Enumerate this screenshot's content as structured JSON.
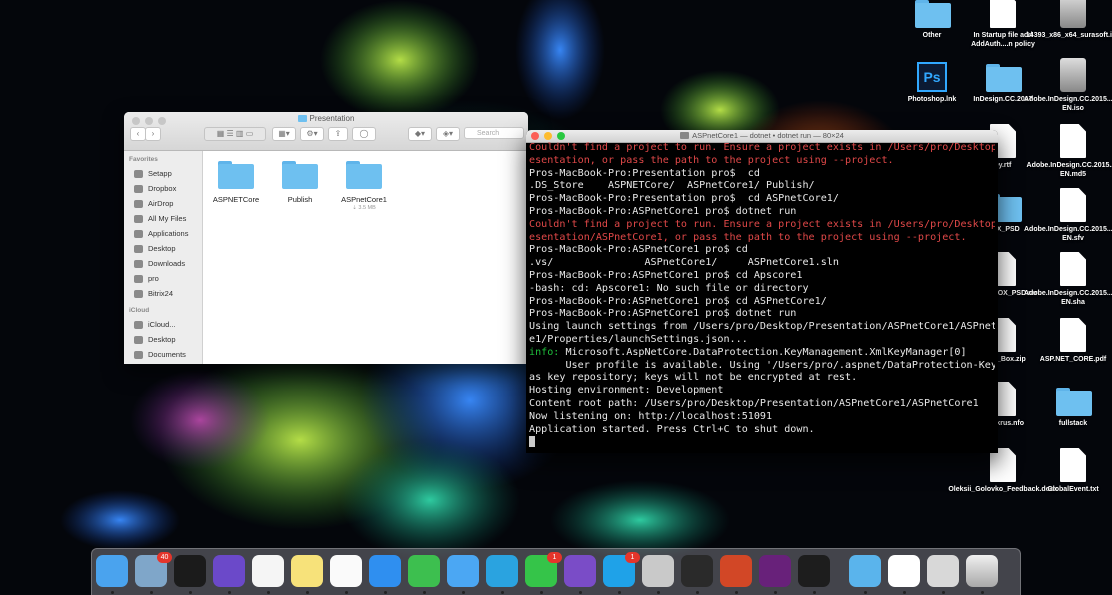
{
  "desktop": {
    "icons": [
      {
        "label": "Other",
        "type": "folder"
      },
      {
        "label": "In Startup file add AddAuth....n policy",
        "type": "doc"
      },
      {
        "label": "14393_x86_x64_surasoft.iso",
        "type": "disk"
      },
      {
        "label": "Photoshop.lnk",
        "type": "ps"
      },
      {
        "label": "InDesign.CC.2017",
        "type": "folder"
      },
      {
        "label": "Adobe.InDesign.CC.2015....U-EN.iso",
        "type": "disk"
      },
      {
        "label": "ey.rtf",
        "type": "doc"
      },
      {
        "label": "Adobe.InDesign.CC.2015....-EN.md5",
        "type": "doc"
      },
      {
        "label": "BOX_PSD",
        "type": "folder"
      },
      {
        "label": "Adobe.InDesign.CC.2015....U-EN.sfv",
        "type": "doc"
      },
      {
        "label": "LOOK_BOX_PSD.rar",
        "type": "doc"
      },
      {
        "label": "Adobe.InDesign.CC.2015....U-EN.sha",
        "type": "doc"
      },
      {
        "label": "Look_Box.zip",
        "type": "doc"
      },
      {
        "label": "ASP.NET_CORE.pdf",
        "type": "doc"
      },
      {
        "label": "mOrkrus.nfo",
        "type": "doc"
      },
      {
        "label": "fullstack",
        "type": "folder"
      },
      {
        "label": "Oleksii_Golovko_Feedback.docx",
        "type": "doc"
      },
      {
        "label": "GlobalEvent.txt",
        "type": "doc"
      }
    ]
  },
  "finder": {
    "title": "Presentation",
    "search_placeholder": "Search",
    "sidebar": {
      "favorites_header": "Favorites",
      "favorites": [
        "Setapp",
        "Dropbox",
        "AirDrop",
        "All My Files",
        "Applications",
        "Desktop",
        "Downloads",
        "pro",
        "Bitrix24"
      ],
      "icloud_header": "iCloud",
      "icloud": [
        "iCloud...",
        "Desktop",
        "Documents"
      ]
    },
    "items": [
      {
        "name": "ASPNETCore",
        "size": ""
      },
      {
        "name": "Publish",
        "size": ""
      },
      {
        "name": "ASPnetCore1",
        "size": "3.5 MB"
      }
    ]
  },
  "terminal": {
    "title": "ASPnetCore1 — dotnet • dotnet run — 80×24",
    "lines": [
      {
        "text": "Couldn't find a project to run. Ensure a project exists in /Users/pro/Desktop/Pr",
        "style": "err"
      },
      {
        "text": "esentation, or pass the path to the project using --project.",
        "style": "err"
      },
      {
        "text": "Pros-MacBook-Pro:Presentation pro$  cd",
        "style": ""
      },
      {
        "text": ".DS_Store    ASPNETCore/  ASPnetCore1/ Publish/",
        "style": ""
      },
      {
        "text": "Pros-MacBook-Pro:Presentation pro$  cd ASPnetCore1/",
        "style": ""
      },
      {
        "text": "Pros-MacBook-Pro:ASPnetCore1 pro$ dotnet run",
        "style": ""
      },
      {
        "text": "Couldn't find a project to run. Ensure a project exists in /Users/pro/Desktop/Pr",
        "style": "err"
      },
      {
        "text": "esentation/ASPnetCore1, or pass the path to the project using --project.",
        "style": "err"
      },
      {
        "text": "Pros-MacBook-Pro:ASPnetCore1 pro$ cd",
        "style": ""
      },
      {
        "text": ".vs/               ASPnetCore1/     ASPnetCore1.sln",
        "style": ""
      },
      {
        "text": "Pros-MacBook-Pro:ASPnetCore1 pro$ cd Apscore1",
        "style": ""
      },
      {
        "text": "-bash: cd: Apscore1: No such file or directory",
        "style": ""
      },
      {
        "text": "Pros-MacBook-Pro:ASPnetCore1 pro$ cd ASPnetCore1/",
        "style": ""
      },
      {
        "text": "Pros-MacBook-Pro:ASPnetCore1 pro$ dotnet run",
        "style": ""
      },
      {
        "text": "Using launch settings from /Users/pro/Desktop/Presentation/ASPnetCore1/ASPnetCor",
        "style": ""
      },
      {
        "text": "e1/Properties/launchSettings.json...",
        "style": ""
      },
      {
        "text": "info: Microsoft.AspNetCore.DataProtection.KeyManagement.XmlKeyManager[0]",
        "style": "info"
      },
      {
        "text": "      User profile is available. Using '/Users/pro/.aspnet/DataProtection-Keys'",
        "style": ""
      },
      {
        "text": "as key repository; keys will not be encrypted at rest.",
        "style": ""
      },
      {
        "text": "Hosting environment: Development",
        "style": ""
      },
      {
        "text": "Content root path: /Users/pro/Desktop/Presentation/ASPnetCore1/ASPnetCore1",
        "style": ""
      },
      {
        "text": "Now listening on: http://localhost:51091",
        "style": ""
      },
      {
        "text": "Application started. Press Ctrl+C to shut down.",
        "style": ""
      }
    ]
  },
  "dock": {
    "apps": [
      {
        "name": "finder",
        "color": "#4aa3ee",
        "badge": ""
      },
      {
        "name": "mail",
        "color": "#7fa6c9",
        "badge": "40"
      },
      {
        "name": "terminal",
        "color": "#1b1b1b",
        "badge": ""
      },
      {
        "name": "siri",
        "color": "#6b49c9",
        "badge": ""
      },
      {
        "name": "photos",
        "color": "#f5f5f5",
        "badge": ""
      },
      {
        "name": "notes",
        "color": "#f7e27a",
        "badge": ""
      },
      {
        "name": "reminders",
        "color": "#fafafa",
        "badge": ""
      },
      {
        "name": "safari",
        "color": "#2f8ff0",
        "badge": ""
      },
      {
        "name": "facetime",
        "color": "#3dbf4f",
        "badge": ""
      },
      {
        "name": "messages",
        "color": "#4ba7f3",
        "badge": ""
      },
      {
        "name": "telegram",
        "color": "#2aa3e0",
        "badge": ""
      },
      {
        "name": "whatsapp",
        "color": "#35c449",
        "badge": "1"
      },
      {
        "name": "viber",
        "color": "#7a4cc7",
        "badge": ""
      },
      {
        "name": "skype",
        "color": "#1fa2e8",
        "badge": "1"
      },
      {
        "name": "parallels",
        "color": "#c9c9c9",
        "badge": ""
      },
      {
        "name": "windows-app",
        "color": "#2a2a2a",
        "badge": ""
      },
      {
        "name": "powerpoint",
        "color": "#d24726",
        "badge": ""
      },
      {
        "name": "visual-studio",
        "color": "#68217a",
        "badge": ""
      },
      {
        "name": "quicktime",
        "color": "#1d1d1d",
        "badge": ""
      },
      {
        "name": "downloads-stack",
        "color": "#5ab4ec",
        "badge": ""
      },
      {
        "name": "dotnet-stack",
        "color": "#ffffff",
        "badge": ""
      },
      {
        "name": "screen-stack",
        "color": "#d8d8d8",
        "badge": ""
      },
      {
        "name": "trash",
        "color": "#cfcfcf",
        "badge": ""
      }
    ]
  }
}
